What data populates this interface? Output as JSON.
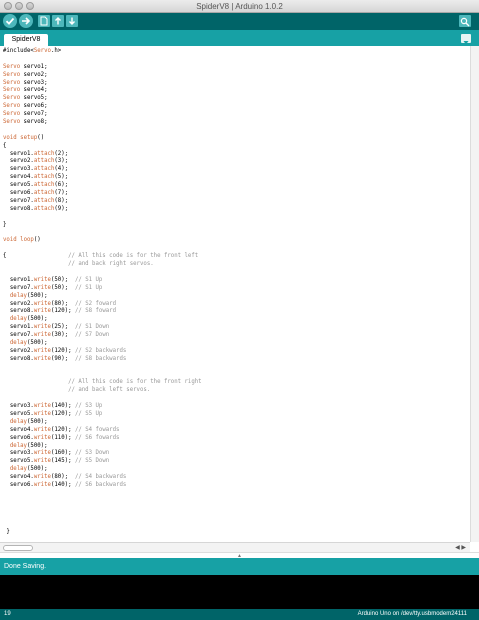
{
  "window": {
    "title": "SpiderV8 | Arduino 1.0.2"
  },
  "toolbar": {
    "buttons": [
      {
        "name": "verify-button",
        "icon": "check-icon"
      },
      {
        "name": "upload-button",
        "icon": "arrow-right-icon"
      },
      {
        "name": "new-button",
        "icon": "new-file-icon"
      },
      {
        "name": "open-button",
        "icon": "open-arrow-up-icon"
      },
      {
        "name": "save-button",
        "icon": "save-arrow-down-icon"
      }
    ],
    "serial_monitor_icon": "magnifier-icon"
  },
  "tabs": {
    "active": "SpiderV8",
    "menu_icon": "triangle-down-icon"
  },
  "code_lines": [
    [
      [
        "t",
        "#include<"
      ],
      [
        "k",
        "Servo"
      ],
      [
        "t",
        ".h>"
      ]
    ],
    [],
    [
      [
        "k",
        "Servo"
      ],
      [
        "t",
        " servo1;"
      ]
    ],
    [
      [
        "k",
        "Servo"
      ],
      [
        "t",
        " servo2;"
      ]
    ],
    [
      [
        "k",
        "Servo"
      ],
      [
        "t",
        " servo3;"
      ]
    ],
    [
      [
        "k",
        "Servo"
      ],
      [
        "t",
        " servo4;"
      ]
    ],
    [
      [
        "k",
        "Servo"
      ],
      [
        "t",
        " servo5;"
      ]
    ],
    [
      [
        "k",
        "Servo"
      ],
      [
        "t",
        " servo6;"
      ]
    ],
    [
      [
        "k",
        "Servo"
      ],
      [
        "t",
        " servo7;"
      ]
    ],
    [
      [
        "k",
        "Servo"
      ],
      [
        "t",
        " servo8;"
      ]
    ],
    [],
    [
      [
        "k",
        "void"
      ],
      [
        "t",
        " "
      ],
      [
        "k",
        "setup"
      ],
      [
        "t",
        "()"
      ]
    ],
    [
      [
        "t",
        "{"
      ]
    ],
    [
      [
        "t",
        "  servo1."
      ],
      [
        "k",
        "attach"
      ],
      [
        "t",
        "(2);"
      ]
    ],
    [
      [
        "t",
        "  servo2."
      ],
      [
        "k",
        "attach"
      ],
      [
        "t",
        "(3);"
      ]
    ],
    [
      [
        "t",
        "  servo3."
      ],
      [
        "k",
        "attach"
      ],
      [
        "t",
        "(4);"
      ]
    ],
    [
      [
        "t",
        "  servo4."
      ],
      [
        "k",
        "attach"
      ],
      [
        "t",
        "(5);"
      ]
    ],
    [
      [
        "t",
        "  servo5."
      ],
      [
        "k",
        "attach"
      ],
      [
        "t",
        "(6);"
      ]
    ],
    [
      [
        "t",
        "  servo6."
      ],
      [
        "k",
        "attach"
      ],
      [
        "t",
        "(7);"
      ]
    ],
    [
      [
        "t",
        "  servo7."
      ],
      [
        "k",
        "attach"
      ],
      [
        "t",
        "(8);"
      ]
    ],
    [
      [
        "t",
        "  servo8."
      ],
      [
        "k",
        "attach"
      ],
      [
        "t",
        "(9);"
      ]
    ],
    [],
    [
      [
        "t",
        "}"
      ]
    ],
    [],
    [
      [
        "k",
        "void"
      ],
      [
        "t",
        " "
      ],
      [
        "k",
        "loop"
      ],
      [
        "t",
        "()"
      ]
    ],
    [],
    [
      [
        "t",
        "{                  "
      ],
      [
        "c",
        "// All this code is for the front left"
      ]
    ],
    [
      [
        "t",
        "                   "
      ],
      [
        "c",
        "// and back right servos."
      ]
    ],
    [],
    [
      [
        "t",
        "  servo1."
      ],
      [
        "k",
        "write"
      ],
      [
        "t",
        "(50);  "
      ],
      [
        "c",
        "// S1 Up"
      ]
    ],
    [
      [
        "t",
        "  servo7."
      ],
      [
        "k",
        "write"
      ],
      [
        "t",
        "(50);  "
      ],
      [
        "c",
        "// S1 Up"
      ]
    ],
    [
      [
        "t",
        "  "
      ],
      [
        "k",
        "delay"
      ],
      [
        "t",
        "(500);"
      ]
    ],
    [
      [
        "t",
        "  servo2."
      ],
      [
        "k",
        "write"
      ],
      [
        "t",
        "(80);  "
      ],
      [
        "c",
        "// S2 foward"
      ]
    ],
    [
      [
        "t",
        "  servo8."
      ],
      [
        "k",
        "write"
      ],
      [
        "t",
        "(120); "
      ],
      [
        "c",
        "// S8 foward"
      ]
    ],
    [
      [
        "t",
        "  "
      ],
      [
        "k",
        "delay"
      ],
      [
        "t",
        "(500);"
      ]
    ],
    [
      [
        "t",
        "  servo1."
      ],
      [
        "k",
        "write"
      ],
      [
        "t",
        "(25);  "
      ],
      [
        "c",
        "// S1 Down"
      ]
    ],
    [
      [
        "t",
        "  servo7."
      ],
      [
        "k",
        "write"
      ],
      [
        "t",
        "(30);  "
      ],
      [
        "c",
        "// S7 Down"
      ]
    ],
    [
      [
        "t",
        "  "
      ],
      [
        "k",
        "delay"
      ],
      [
        "t",
        "(500);"
      ]
    ],
    [
      [
        "t",
        "  servo2."
      ],
      [
        "k",
        "write"
      ],
      [
        "t",
        "(120); "
      ],
      [
        "c",
        "// S2 backwards"
      ]
    ],
    [
      [
        "t",
        "  servo8."
      ],
      [
        "k",
        "write"
      ],
      [
        "t",
        "(90);  "
      ],
      [
        "c",
        "// S8 backwards"
      ]
    ],
    [],
    [],
    [
      [
        "t",
        "                   "
      ],
      [
        "c",
        "// All this code is for the front right"
      ]
    ],
    [
      [
        "t",
        "                   "
      ],
      [
        "c",
        "// and back left servos."
      ]
    ],
    [],
    [
      [
        "t",
        "  servo3."
      ],
      [
        "k",
        "write"
      ],
      [
        "t",
        "(140); "
      ],
      [
        "c",
        "// S3 Up"
      ]
    ],
    [
      [
        "t",
        "  servo5."
      ],
      [
        "k",
        "write"
      ],
      [
        "t",
        "(120); "
      ],
      [
        "c",
        "// S5 Up"
      ]
    ],
    [
      [
        "t",
        "  "
      ],
      [
        "k",
        "delay"
      ],
      [
        "t",
        "(500);"
      ]
    ],
    [
      [
        "t",
        "  servo4."
      ],
      [
        "k",
        "write"
      ],
      [
        "t",
        "(120); "
      ],
      [
        "c",
        "// S4 fowards"
      ]
    ],
    [
      [
        "t",
        "  servo6."
      ],
      [
        "k",
        "write"
      ],
      [
        "t",
        "(110); "
      ],
      [
        "c",
        "// S6 fowards"
      ]
    ],
    [
      [
        "t",
        "  "
      ],
      [
        "k",
        "delay"
      ],
      [
        "t",
        "(500);"
      ]
    ],
    [
      [
        "t",
        "  servo3."
      ],
      [
        "k",
        "write"
      ],
      [
        "t",
        "(160); "
      ],
      [
        "c",
        "// S3 Down"
      ]
    ],
    [
      [
        "t",
        "  servo5."
      ],
      [
        "k",
        "write"
      ],
      [
        "t",
        "(145); "
      ],
      [
        "c",
        "// S5 Down"
      ]
    ],
    [
      [
        "t",
        "  "
      ],
      [
        "k",
        "delay"
      ],
      [
        "t",
        "(500);"
      ]
    ],
    [
      [
        "t",
        "  servo4."
      ],
      [
        "k",
        "write"
      ],
      [
        "t",
        "(80);  "
      ],
      [
        "c",
        "// S4 backwards"
      ]
    ],
    [
      [
        "t",
        "  servo6."
      ],
      [
        "k",
        "write"
      ],
      [
        "t",
        "(140); "
      ],
      [
        "c",
        "// S6 backwards"
      ]
    ],
    [],
    [],
    [],
    [],
    [],
    [
      [
        "t",
        " }"
      ]
    ]
  ],
  "status": {
    "message": "Done Saving."
  },
  "footer": {
    "line_number": "19",
    "board": "Arduino Uno on /dev/tty.usbmodem24111"
  },
  "colors": {
    "toolbar": "#006468",
    "accent": "#17a1a5",
    "keyword": "#cc6633",
    "comment": "#999999"
  }
}
